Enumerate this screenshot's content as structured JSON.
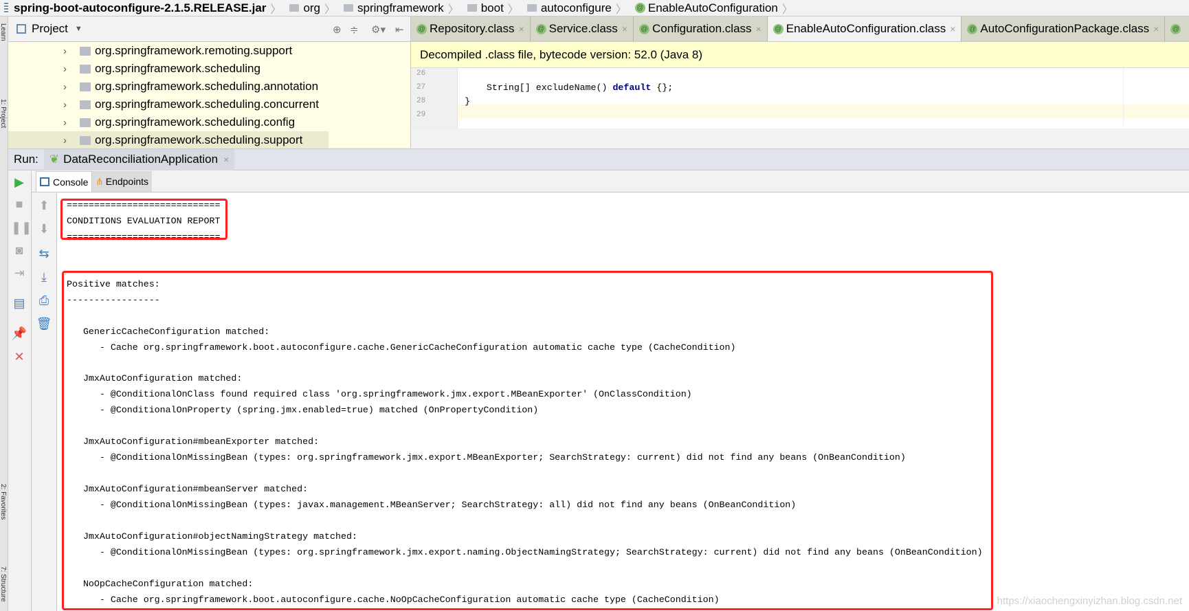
{
  "breadcrumb": [
    "spring-boot-autoconfigure-2.1.5.RELEASE.jar",
    "org",
    "springframework",
    "boot",
    "autoconfigure",
    "EnableAutoConfiguration"
  ],
  "left_strip": [
    "Learn",
    "1: Project",
    "2: Favorites",
    "7: Structure"
  ],
  "project": {
    "title": "Project",
    "items": [
      "org.springframework.remoting.support",
      "org.springframework.scheduling",
      "org.springframework.scheduling.annotation",
      "org.springframework.scheduling.concurrent",
      "org.springframework.scheduling.config",
      "org.springframework.scheduling.support"
    ]
  },
  "editor": {
    "tabs": [
      {
        "label": "Repository.class",
        "active": false
      },
      {
        "label": "Service.class",
        "active": false
      },
      {
        "label": "Configuration.class",
        "active": false
      },
      {
        "label": "EnableAutoConfiguration.class",
        "active": true
      },
      {
        "label": "AutoConfigurationPackage.class",
        "active": false
      }
    ],
    "banner": "Decompiled .class file, bytecode version: 52.0 (Java 8)",
    "lines": [
      {
        "n": "26",
        "pre": "",
        "kw": "",
        "post": ""
      },
      {
        "n": "27",
        "pre": "    String[] excludeName() ",
        "kw": "default",
        "post": " {};"
      },
      {
        "n": "28",
        "pre": "}",
        "kw": "",
        "post": ""
      },
      {
        "n": "29",
        "pre": "",
        "kw": "",
        "post": ""
      }
    ]
  },
  "run": {
    "label": "Run:",
    "config": "DataReconciliationApplication",
    "tabs": [
      "Console",
      "Endpoints"
    ]
  },
  "console": {
    "lines": [
      "============================",
      "CONDITIONS EVALUATION REPORT",
      "============================",
      "",
      "",
      "Positive matches:",
      "-----------------",
      "",
      "   GenericCacheConfiguration matched:",
      "      - Cache org.springframework.boot.autoconfigure.cache.GenericCacheConfiguration automatic cache type (CacheCondition)",
      "",
      "   JmxAutoConfiguration matched:",
      "      - @ConditionalOnClass found required class 'org.springframework.jmx.export.MBeanExporter' (OnClassCondition)",
      "      - @ConditionalOnProperty (spring.jmx.enabled=true) matched (OnPropertyCondition)",
      "",
      "   JmxAutoConfiguration#mbeanExporter matched:",
      "      - @ConditionalOnMissingBean (types: org.springframework.jmx.export.MBeanExporter; SearchStrategy: current) did not find any beans (OnBeanCondition)",
      "",
      "   JmxAutoConfiguration#mbeanServer matched:",
      "      - @ConditionalOnMissingBean (types: javax.management.MBeanServer; SearchStrategy: all) did not find any beans (OnBeanCondition)",
      "",
      "   JmxAutoConfiguration#objectNamingStrategy matched:",
      "      - @ConditionalOnMissingBean (types: org.springframework.jmx.export.naming.ObjectNamingStrategy; SearchStrategy: current) did not find any beans (OnBeanCondition)",
      "",
      "   NoOpCacheConfiguration matched:",
      "      - Cache org.springframework.boot.autoconfigure.cache.NoOpCacheConfiguration automatic cache type (CacheCondition)"
    ]
  },
  "watermark": "https://xiaochengxinyizhan.blog.csdn.net",
  "colors": {
    "highlight_box": "#ff2020",
    "banner": "#ffffcc",
    "project_bg": "#fffde6"
  }
}
